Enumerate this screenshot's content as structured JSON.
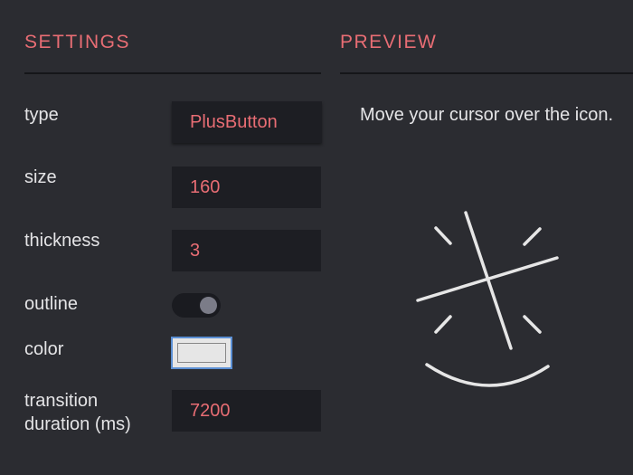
{
  "settings": {
    "heading": "SETTINGS",
    "fields": {
      "type": {
        "label": "type",
        "value": "PlusButton"
      },
      "size": {
        "label": "size",
        "value": "160"
      },
      "thickness": {
        "label": "thickness",
        "value": "3"
      },
      "outline": {
        "label": "outline",
        "state": "on"
      },
      "color": {
        "label": "color",
        "value": "#e6e6e6"
      },
      "transition": {
        "label_line1": "transition",
        "label_line2": "duration (ms)",
        "value": "7200"
      }
    }
  },
  "preview": {
    "heading": "PREVIEW",
    "instruction": "Move your cursor over the icon.",
    "icon_name": "plus-button-morph-icon",
    "icon_color": "#e6e6e6"
  },
  "colors": {
    "background": "#2b2c31",
    "accent": "#e86d74",
    "field_background": "#1d1e23",
    "focus_border": "#5b8fd4"
  }
}
